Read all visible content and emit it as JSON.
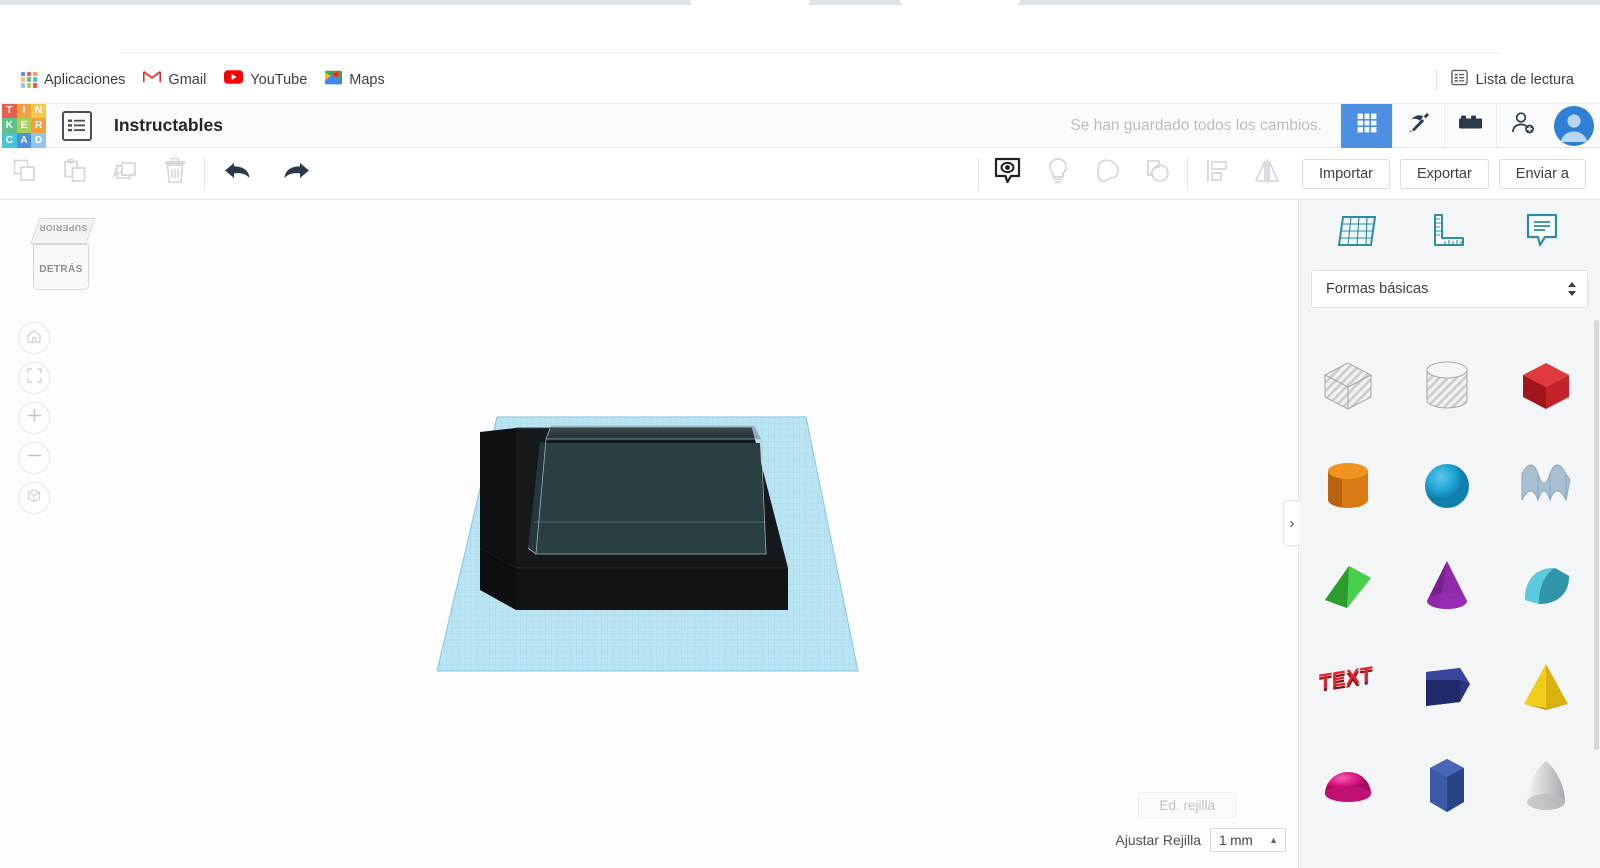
{
  "browser": {
    "bookmarks": [
      {
        "label": "Aplicaciones",
        "icon": "apps-grid-icon"
      },
      {
        "label": "Gmail",
        "icon": "gmail-icon"
      },
      {
        "label": "YouTube",
        "icon": "youtube-icon"
      },
      {
        "label": "Maps",
        "icon": "maps-icon"
      }
    ],
    "reading_list": {
      "label": "Lista de lectura",
      "icon": "reading-list-icon"
    }
  },
  "app_header": {
    "logo": {
      "name": "tinkercad-logo",
      "tiles": [
        {
          "letter": "T",
          "color": "#e8604c"
        },
        {
          "letter": "I",
          "color": "#f2a03d"
        },
        {
          "letter": "N",
          "color": "#f7c845"
        },
        {
          "letter": "K",
          "color": "#5fc08a"
        },
        {
          "letter": "E",
          "color": "#a8d05a"
        },
        {
          "letter": "R",
          "color": "#f2a03d"
        },
        {
          "letter": "C",
          "color": "#47c4d8"
        },
        {
          "letter": "A",
          "color": "#4d8fe0"
        },
        {
          "letter": "D",
          "color": "#8fc7ea"
        }
      ]
    },
    "panel_toggle": "list-panel-icon",
    "doc_title": "Instructables",
    "save_status": "Se han guardado todos los cambios.",
    "actions": [
      {
        "name": "grid-view-button",
        "icon": "grid-3x3-icon",
        "active": true
      },
      {
        "name": "codeblocks-button",
        "icon": "pickaxe-icon",
        "active": false
      },
      {
        "name": "blocks-button",
        "icon": "lego-brick-icon",
        "active": false
      },
      {
        "name": "invite-button",
        "icon": "add-person-icon",
        "active": false
      }
    ],
    "avatar": "user-avatar"
  },
  "edit_toolbar": {
    "left_tools": [
      {
        "name": "copy-button",
        "icon": "copy-icon",
        "enabled": false
      },
      {
        "name": "paste-button",
        "icon": "paste-icon",
        "enabled": false
      },
      {
        "name": "duplicate-button",
        "icon": "duplicate-icon",
        "enabled": false
      },
      {
        "name": "delete-button",
        "icon": "trash-icon",
        "enabled": false
      },
      {
        "name": "undo-button",
        "icon": "undo-arrow-icon",
        "enabled": true
      },
      {
        "name": "redo-button",
        "icon": "redo-arrow-icon",
        "enabled": true
      }
    ],
    "right_tools": [
      {
        "name": "show-hide-button",
        "icon": "eye-bubble-icon",
        "enabled": true
      },
      {
        "name": "light-button",
        "icon": "lightbulb-icon",
        "enabled": false
      },
      {
        "name": "shape-button",
        "icon": "blob-shape-icon",
        "enabled": false
      },
      {
        "name": "group-button",
        "icon": "group-shapes-icon",
        "enabled": false
      },
      {
        "name": "align-button",
        "icon": "align-icon",
        "enabled": false
      },
      {
        "name": "mirror-button",
        "icon": "mirror-icon",
        "enabled": false
      }
    ],
    "buttons": {
      "import": "Importar",
      "export": "Exportar",
      "send_to": "Enviar a"
    }
  },
  "canvas": {
    "view_cube": {
      "top_face": "SUPERIOR",
      "front_face": "DETRÁS"
    },
    "nav_controls": [
      {
        "name": "home-view-button",
        "icon": "home-icon"
      },
      {
        "name": "fit-view-button",
        "icon": "fit-brackets-icon"
      },
      {
        "name": "zoom-in-button",
        "icon": "plus-icon"
      },
      {
        "name": "zoom-out-button",
        "icon": "minus-icon"
      },
      {
        "name": "perspective-toggle-button",
        "icon": "box-perspective-icon"
      }
    ],
    "grid_edit_label": "Ed. rejilla",
    "snap_label": "Ajustar Rejilla",
    "snap_value": "1 mm",
    "workplane_color": "#b6e3f2",
    "model_body_color": "#15181a",
    "model_interior_color": "#2a3f42"
  },
  "shapes_panel": {
    "tabs": [
      {
        "name": "tab-workplane",
        "icon": "workplane-grid-icon"
      },
      {
        "name": "tab-ruler",
        "icon": "ruler-icon"
      },
      {
        "name": "tab-note",
        "icon": "note-bubble-icon"
      }
    ],
    "category": "Formas básicas",
    "collapse_chevron": "›",
    "shapes": [
      {
        "name": "shape-box-hole",
        "label": "Caja hueca",
        "color": "#cfd2d6",
        "kind": "hole-box"
      },
      {
        "name": "shape-cylinder-hole",
        "label": "Cilindro hueco",
        "color": "#cfd2d6",
        "kind": "hole-cylinder"
      },
      {
        "name": "shape-box",
        "label": "Caja",
        "color": "#c8202b",
        "kind": "box"
      },
      {
        "name": "shape-cylinder",
        "label": "Cilindro",
        "color": "#e0861a",
        "kind": "cylinder"
      },
      {
        "name": "shape-sphere",
        "label": "Esfera",
        "color": "#1da3d4",
        "kind": "sphere"
      },
      {
        "name": "shape-scribble",
        "label": "Garabato",
        "color": "#9fb8cc",
        "kind": "scribble"
      },
      {
        "name": "shape-roof",
        "label": "Tejado",
        "color": "#2fa832",
        "kind": "wedge"
      },
      {
        "name": "shape-cone",
        "label": "Cono",
        "color": "#8f2aa8",
        "kind": "cone"
      },
      {
        "name": "shape-round-roof",
        "label": "Tejado redondeado",
        "color": "#3aa8bd",
        "kind": "round-roof"
      },
      {
        "name": "shape-text",
        "label": "TEXT",
        "color": "#cf1f2a",
        "kind": "text"
      },
      {
        "name": "shape-polygon",
        "label": "Polígono",
        "color": "#27307a",
        "kind": "polygon"
      },
      {
        "name": "shape-pyramid",
        "label": "Pirámide",
        "color": "#f2cc1a",
        "kind": "pyramid"
      },
      {
        "name": "shape-half-sphere",
        "label": "Media esfera",
        "color": "#d6127f",
        "kind": "dome"
      },
      {
        "name": "shape-hex-prism",
        "label": "Prisma hexagonal",
        "color": "#33509c",
        "kind": "hex-prism"
      },
      {
        "name": "shape-paraboloid",
        "label": "Paraboloide",
        "color": "#bcc0c4",
        "kind": "paraboloid"
      }
    ]
  }
}
